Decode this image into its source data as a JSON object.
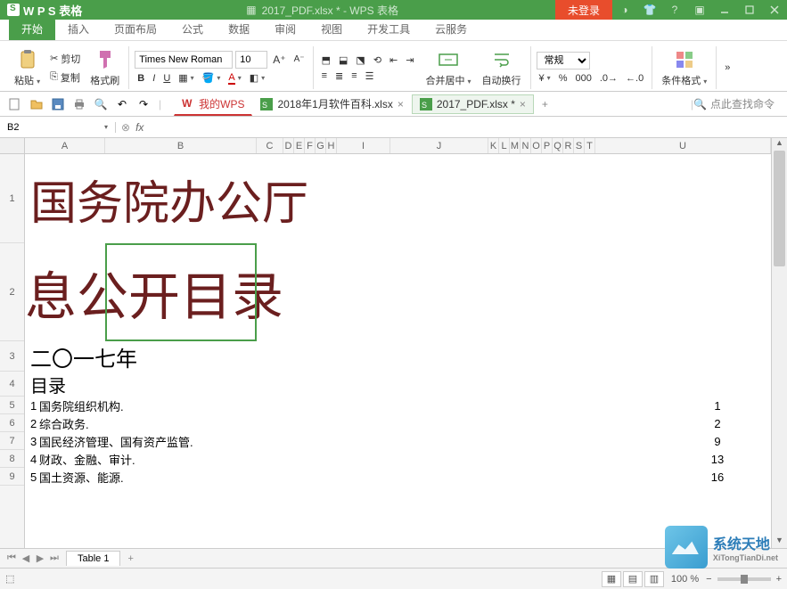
{
  "titlebar": {
    "app_name": "W P S 表格",
    "doc_title": "2017_PDF.xlsx * - WPS 表格",
    "not_logged_in": "未登录"
  },
  "menu": {
    "tabs": [
      "开始",
      "插入",
      "页面布局",
      "公式",
      "数据",
      "审阅",
      "视图",
      "开发工具",
      "云服务"
    ],
    "active": 0
  },
  "ribbon": {
    "paste": "粘贴",
    "cut": "剪切",
    "copy": "复制",
    "format_painter": "格式刷",
    "font_name": "Times New Roman",
    "font_size": "10",
    "merge_center": "合并居中",
    "wrap_text": "自动换行",
    "number_format": "常规",
    "conditional_format": "条件格式"
  },
  "doctabs": [
    {
      "label": "我的WPS",
      "kind": "wps"
    },
    {
      "label": "2018年1月软件百科.xlsx",
      "kind": "xlsx"
    },
    {
      "label": "2017_PDF.xlsx *",
      "kind": "xlsx",
      "active": true
    }
  ],
  "search_placeholder": "点此查找命令",
  "cellref": {
    "name": "B2",
    "formula": ""
  },
  "columns": [
    "A",
    "B",
    "C",
    "D",
    "E",
    "F",
    "G",
    "H",
    "I",
    "J",
    "K",
    "L",
    "M",
    "N",
    "O",
    "P",
    "Q",
    "R",
    "S",
    "T",
    "U"
  ],
  "rows": {
    "r1_text": "国务院办公厅",
    "r2_text": "息公开目录",
    "r3_text": "二〇一七年",
    "r4_text": "目录",
    "data": [
      {
        "idx": "1",
        "text": "国务院组织机构.",
        "page": "1"
      },
      {
        "idx": "2",
        "text": "综合政务.",
        "page": "2"
      },
      {
        "idx": "3",
        "text": "国民经济管理、国有资产监管.",
        "page": "9"
      },
      {
        "idx": "4",
        "text": "财政、金融、审计.",
        "page": "13"
      },
      {
        "idx": "5",
        "text": "国土资源、能源.",
        "page": "16"
      }
    ]
  },
  "row_numbers": [
    "1",
    "2",
    "3",
    "4",
    "5",
    "6",
    "7",
    "8",
    "9"
  ],
  "sheet_tabs": {
    "active": "Table 1"
  },
  "statusbar": {
    "zoom": "100 %"
  },
  "watermark": {
    "cn": "系统天地",
    "en": "XiTongTianDi.net"
  }
}
